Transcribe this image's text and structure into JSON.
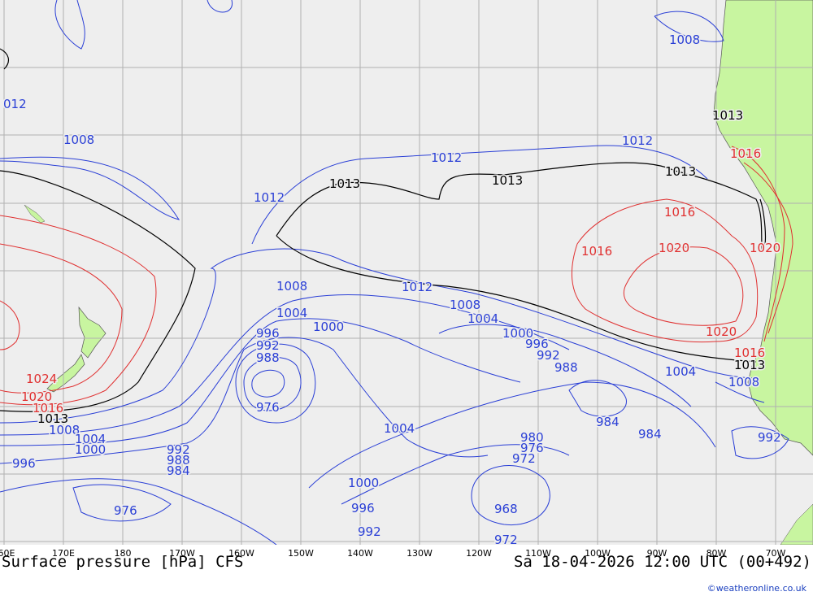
{
  "title": {
    "left": "Surface pressure [hPa] CFS",
    "right": "Sa 18-04-2026 12:00 UTC (00+492)"
  },
  "credit": "©weatheronline.co.uk",
  "lon_labels": [
    "60E",
    "170E",
    "180",
    "170W",
    "160W",
    "150W",
    "140W",
    "130W",
    "120W",
    "110W",
    "100W",
    "90W",
    "80W",
    "70W"
  ],
  "isobar_labels": {
    "blue": [
      "012",
      "1008",
      "1012",
      "1012",
      "1012",
      "1008",
      "1004",
      "1000",
      "996",
      "992",
      "988",
      "976",
      "1008",
      "1004",
      "1000",
      "996",
      "992",
      "988",
      "984",
      "980",
      "976",
      "972",
      "968",
      "976",
      "1004",
      "1000",
      "996",
      "992",
      "984",
      "984",
      "988",
      "992",
      "996",
      "1000",
      "1004",
      "1008",
      "1008",
      "1004",
      "992",
      "972"
    ],
    "black": [
      "1013",
      "1013",
      "1013",
      "1013",
      "1013",
      "1013"
    ],
    "red": [
      "1016",
      "1016",
      "1016",
      "1020",
      "1020",
      "1016",
      "1020",
      "1024",
      "1020",
      "1016"
    ]
  },
  "colors": {
    "ocean": "#eeeeee",
    "land": "#c8f5a0",
    "grid": "#b0b0b0",
    "isobar_low": "#2a3fd6",
    "isobar_mean": "#000000",
    "isobar_high": "#e03030"
  }
}
